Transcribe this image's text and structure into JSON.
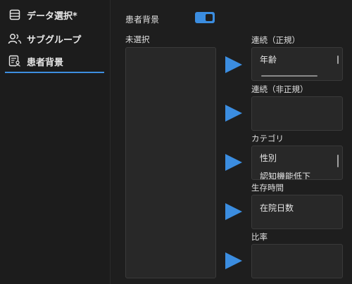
{
  "sidebar": {
    "items": [
      {
        "label": "データ選択*",
        "icon": "table-icon"
      },
      {
        "label": "サブグループ",
        "icon": "users-icon"
      },
      {
        "label": "患者背景",
        "icon": "patient-report-icon"
      }
    ],
    "active_index": 2,
    "accent_color": "#3d8fe0"
  },
  "main": {
    "toggle_label": "患者背景",
    "toggle_on": true,
    "unselected_label": "未選択",
    "groups": [
      {
        "label": "連続（正規）",
        "items": [
          "年齢"
        ]
      },
      {
        "label": "連続（非正規）",
        "items": []
      },
      {
        "label": "カテゴリ",
        "items": [
          "性別",
          "認知機能低下"
        ]
      },
      {
        "label": "生存時間",
        "items": [
          "在院日数"
        ]
      },
      {
        "label": "比率",
        "items": []
      }
    ]
  }
}
